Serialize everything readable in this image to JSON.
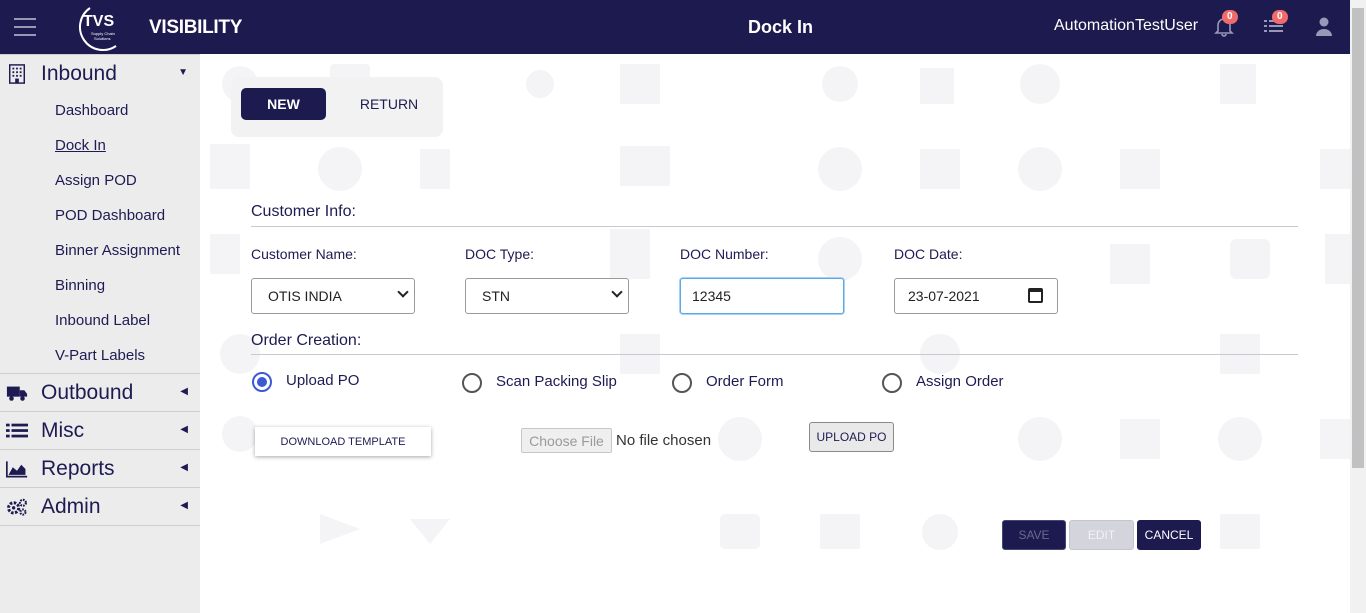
{
  "header": {
    "brand": "VISIBILITY",
    "logo_text": "TVS",
    "logo_subtext": "Supply Chain Solutions",
    "title": "Dock In",
    "username": "AutomationTestUser",
    "notifications_count": "0",
    "tasks_count": "0",
    "icons": [
      "hamburger-icon",
      "bell-icon",
      "list-icon",
      "user-icon"
    ],
    "colors": {
      "header_bg": "#1d1a4f",
      "badge": "#ef6b6b"
    }
  },
  "sidebar": {
    "sections": [
      {
        "label": "Inbound",
        "icon": "building-icon",
        "expanded": true
      },
      {
        "label": "Outbound",
        "icon": "truck-icon",
        "expanded": false
      },
      {
        "label": "Misc",
        "icon": "list-icon",
        "expanded": false
      },
      {
        "label": "Reports",
        "icon": "area-chart-icon",
        "expanded": false
      },
      {
        "label": "Admin",
        "icon": "gears-icon",
        "expanded": false
      }
    ],
    "inbound_items": [
      {
        "label": "Dashboard"
      },
      {
        "label": "Dock In",
        "active": true
      },
      {
        "label": "Assign POD"
      },
      {
        "label": "POD Dashboard"
      },
      {
        "label": "Binner Assignment"
      },
      {
        "label": "Binning"
      },
      {
        "label": "Inbound Label"
      },
      {
        "label": "V-Part Labels"
      }
    ]
  },
  "main": {
    "mode_toggle": {
      "new_label": "NEW",
      "return_label": "RETURN",
      "selected": "NEW"
    },
    "customer_info": {
      "title": "Customer Info:",
      "customer_name_label": "Customer Name:",
      "customer_name_value": "OTIS INDIA",
      "doc_type_label": "DOC Type:",
      "doc_type_value": "STN",
      "doc_number_label": "DOC Number:",
      "doc_number_value": "12345",
      "doc_date_label": "DOC Date:",
      "doc_date_value": "23-07-2021"
    },
    "order_creation": {
      "title": "Order Creation:",
      "options": [
        "Upload PO",
        "Scan Packing Slip",
        "Order Form",
        "Assign Order"
      ],
      "selected": "Upload PO"
    },
    "upload": {
      "download_template_label": "DOWNLOAD TEMPLATE",
      "choose_file_label": "Choose File",
      "no_file_text": "No file chosen",
      "upload_po_label": "UPLOAD PO"
    },
    "actions": {
      "save_label": "SAVE",
      "edit_label": "EDIT",
      "cancel_label": "CANCEL"
    }
  }
}
